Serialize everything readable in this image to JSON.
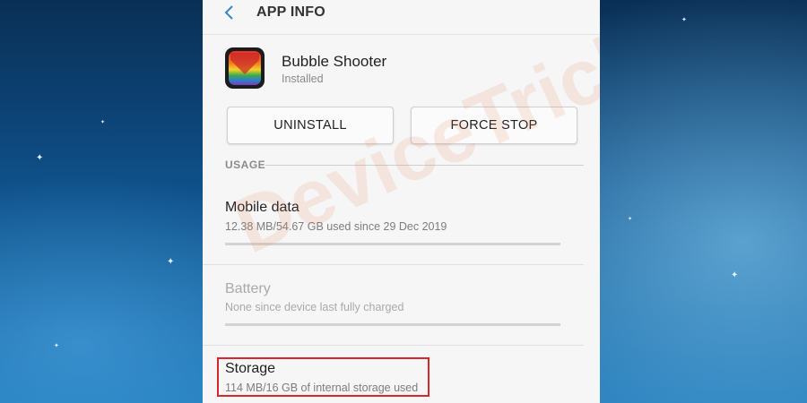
{
  "header": {
    "title": "APP INFO"
  },
  "app": {
    "name": "Bubble Shooter",
    "status": "Installed"
  },
  "buttons": {
    "uninstall": "UNINSTALL",
    "force_stop": "FORCE STOP"
  },
  "usage": {
    "label": "USAGE",
    "mobile_data": {
      "title": "Mobile data",
      "detail": "12.38 MB/54.67 GB used since 29 Dec 2019"
    },
    "battery": {
      "title": "Battery",
      "detail": "None since device last fully charged"
    }
  },
  "storage": {
    "title": "Storage",
    "detail": "114 MB/16 GB of internal storage used"
  },
  "watermark": "DeviceTricks",
  "colors": {
    "highlight": "#d8262d",
    "back_arrow": "#2f87c8",
    "panel_bg": "#f6f6f6"
  }
}
